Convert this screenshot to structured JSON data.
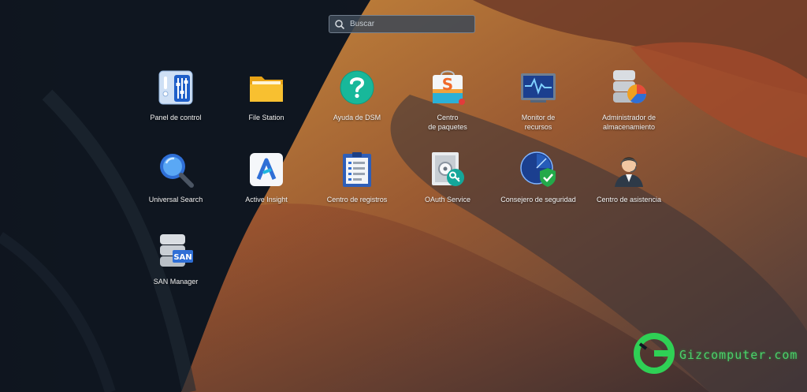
{
  "search": {
    "placeholder": "Buscar",
    "icon": "search-icon"
  },
  "apps": [
    {
      "label": "Panel de control",
      "icon": "control-panel-icon"
    },
    {
      "label": "File Station",
      "icon": "folder-icon"
    },
    {
      "label": "Ayuda de DSM",
      "icon": "help-icon"
    },
    {
      "label": "Centro\nde paquetes",
      "icon": "package-center-icon"
    },
    {
      "label": "Monitor de\nrecursos",
      "icon": "resource-monitor-icon"
    },
    {
      "label": "Administrador de\nalmacenamiento",
      "icon": "storage-manager-icon"
    },
    {
      "label": "Universal Search",
      "icon": "magnifier-icon"
    },
    {
      "label": "Active Insight",
      "icon": "active-insight-icon"
    },
    {
      "label": "Centro de registros",
      "icon": "log-center-icon"
    },
    {
      "label": "OAuth Service",
      "icon": "oauth-key-icon"
    },
    {
      "label": "Consejero de seguridad",
      "icon": "security-shield-icon"
    },
    {
      "label": "Centro de asistencia",
      "icon": "support-agent-icon"
    },
    {
      "label": "SAN Manager",
      "icon": "san-manager-icon"
    }
  ],
  "san_badge": "SAN",
  "watermark": {
    "text": "Gizcomputer.com",
    "color": "#4bd06a"
  }
}
